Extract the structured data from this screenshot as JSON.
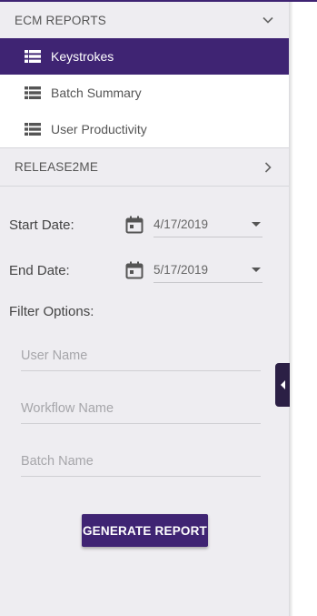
{
  "sidebar": {
    "ecm_section": {
      "title": "ECM REPORTS",
      "expanded": true
    },
    "items": [
      {
        "label": "Keystrokes",
        "active": true,
        "icon": "list-icon"
      },
      {
        "label": "Batch Summary",
        "active": false,
        "icon": "list-icon"
      },
      {
        "label": "User Productivity",
        "active": false,
        "icon": "list-icon"
      }
    ],
    "release_section": {
      "title": "RELEASE2ME",
      "expanded": false
    }
  },
  "form": {
    "start_date": {
      "label": "Start Date:",
      "value": "4/17/2019"
    },
    "end_date": {
      "label": "End Date:",
      "value": "5/17/2019"
    },
    "filter_label": "Filter Options:",
    "user_name": {
      "placeholder": "User Name"
    },
    "workflow_name": {
      "placeholder": "Workflow Name"
    },
    "batch_name": {
      "placeholder": "Batch Name"
    },
    "generate_label": "GENERATE REPORT"
  },
  "colors": {
    "accent": "#3f2473",
    "sidebar_bg": "#eeedf1",
    "collapse_tab": "#2b1f45"
  }
}
